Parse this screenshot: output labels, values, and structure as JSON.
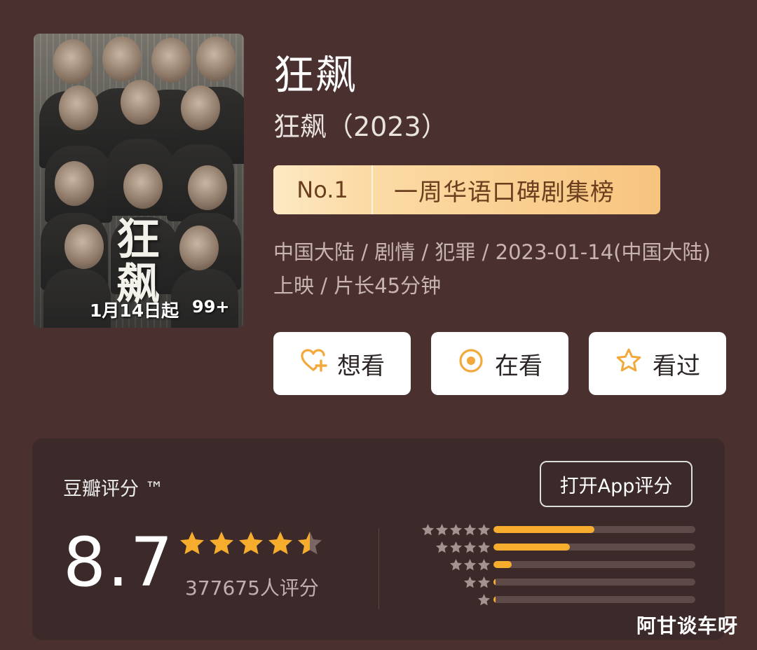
{
  "poster": {
    "title_art": "狂飙",
    "date_label": "1月14日起",
    "count_label": "99+"
  },
  "header": {
    "title": "狂飙",
    "subtitle": "狂飙（2023）",
    "rank": {
      "number": "No.1",
      "list": "一周华语口碑剧集榜"
    },
    "meta": "中国大陆 / 剧情 / 犯罪 / 2023-01-14(中国大陆)上映 / 片长45分钟"
  },
  "actions": [
    {
      "label": "想看",
      "icon": "heart-plus-icon"
    },
    {
      "label": "在看",
      "icon": "target-icon"
    },
    {
      "label": "看过",
      "icon": "star-outline-icon"
    }
  ],
  "rating": {
    "label": "豆瓣评分 ™",
    "open_app": "打开App评分",
    "score": "8.7",
    "stars": 4.5,
    "votes": "377675人评分",
    "distribution": [
      {
        "stars": 5,
        "fraction": 0.5
      },
      {
        "stars": 4,
        "fraction": 0.38
      },
      {
        "stars": 3,
        "fraction": 0.09
      },
      {
        "stars": 2,
        "fraction": 0.01
      },
      {
        "stars": 1,
        "fraction": 0.01
      }
    ]
  },
  "watermark": "阿甘谈车呀",
  "colors": {
    "background": "#4a3130",
    "panel": "#3c2a2a",
    "accent_star": "#f6ac2d",
    "badge_text": "#6b3e1e"
  }
}
